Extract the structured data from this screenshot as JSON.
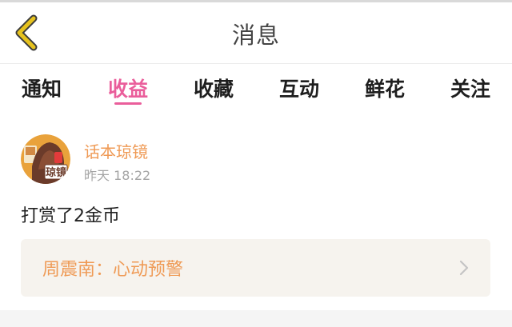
{
  "header": {
    "title": "消息",
    "back_icon": "chevron-left-icon",
    "back_color": "#e6c21e"
  },
  "tabs": [
    {
      "label": "通知",
      "active": false
    },
    {
      "label": "收益",
      "active": true
    },
    {
      "label": "收藏",
      "active": false
    },
    {
      "label": "互动",
      "active": false
    },
    {
      "label": "鲜花",
      "active": false
    },
    {
      "label": "关注",
      "active": false
    }
  ],
  "colors": {
    "accent": "#ea5e9b",
    "name_orange": "#ef9a55",
    "card_bg": "#f6f3ee"
  },
  "message": {
    "sender": "话本琼镜",
    "avatar_text": "琼镜",
    "time": "昨天 18:22",
    "text": "打赏了2金币",
    "quote": "周震南：心动预警",
    "quote_icon": "chevron-right-icon"
  }
}
